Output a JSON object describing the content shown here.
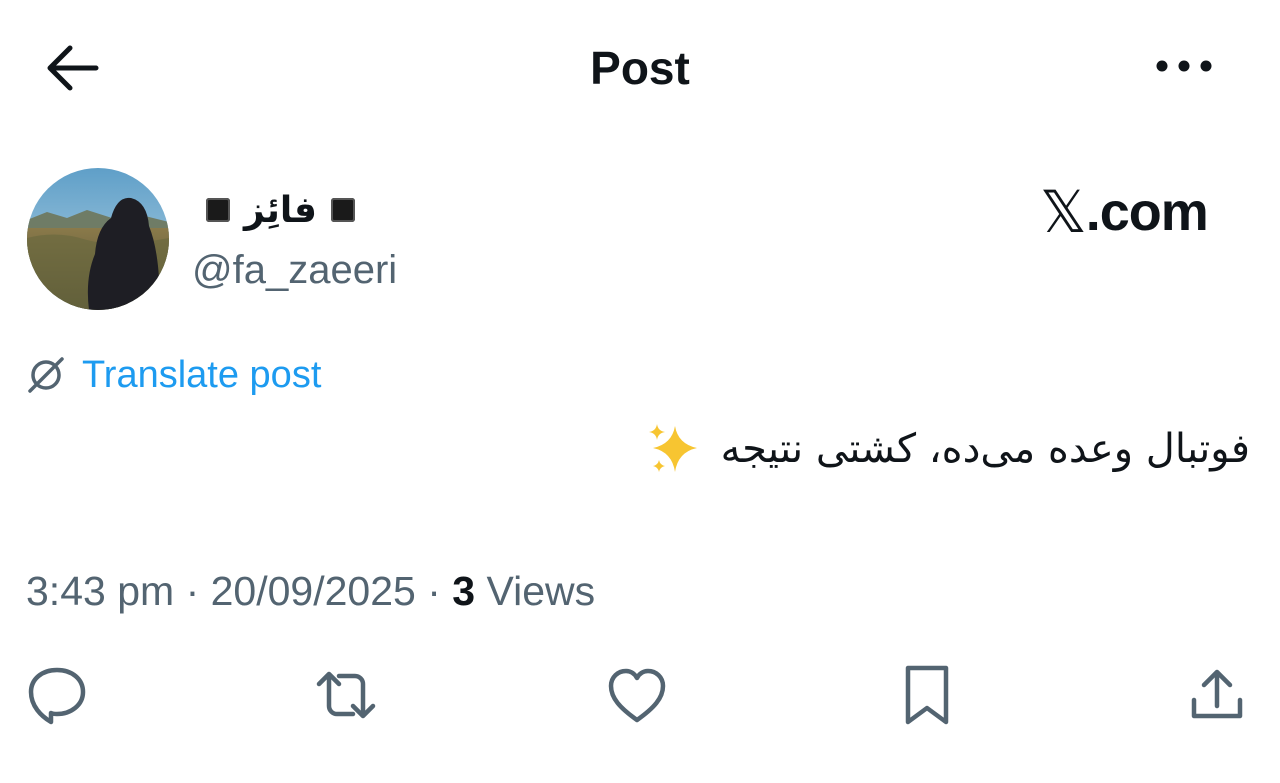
{
  "header": {
    "title": "Post",
    "back_icon": "arrow-left-icon",
    "more_icon": "more-horizontal-icon"
  },
  "author": {
    "name": "فائِز",
    "handle": "@fa_zaeeri",
    "avatar_icon": "profile-photo"
  },
  "site_badge": {
    "logo": "𝕏",
    "text": ".com"
  },
  "translate": {
    "label": "Translate post",
    "icon": "globe-slash-icon"
  },
  "post": {
    "text": "فوتبال وعده می‌ده، کشتی نتیجه",
    "emoji": "✨"
  },
  "meta": {
    "time": "3:43 pm",
    "separator": "·",
    "date": "20/09/2025",
    "views_count": "3",
    "views_label": "Views"
  },
  "actions": {
    "reply_icon": "reply-icon",
    "repost_icon": "repost-icon",
    "like_icon": "heart-icon",
    "bookmark_icon": "bookmark-icon",
    "share_icon": "share-icon"
  },
  "colors": {
    "text": "#0f1419",
    "secondary": "#536471",
    "link": "#1d9bf0",
    "background": "#ffffff"
  }
}
